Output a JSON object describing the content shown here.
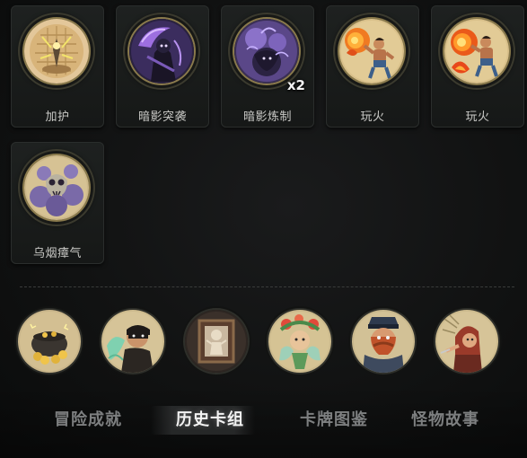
{
  "cards": [
    {
      "name": "加护",
      "icon": "golden-shield-aura-icon",
      "count": ""
    },
    {
      "name": "暗影突袭",
      "icon": "shadow-reaper-icon",
      "count": ""
    },
    {
      "name": "暗影炼制",
      "icon": "shadow-forge-icon",
      "count": "x2"
    },
    {
      "name": "玩火",
      "icon": "fire-brawler-icon",
      "count": ""
    },
    {
      "name": "玩火",
      "icon": "fire-brawler-icon",
      "count": ""
    },
    {
      "name": "乌烟瘴气",
      "icon": "smoke-skull-icon",
      "count": ""
    }
  ],
  "relics": [
    {
      "icon": "treasure-cauldron-icon"
    },
    {
      "icon": "masked-thief-icon"
    },
    {
      "icon": "framed-portrait-icon"
    },
    {
      "icon": "flower-dryad-icon"
    },
    {
      "icon": "mustached-officer-icon"
    },
    {
      "icon": "hooded-rogue-icon"
    }
  ],
  "tabs": [
    {
      "label": "冒险成就",
      "active": false
    },
    {
      "label": "历史卡组",
      "active": true
    },
    {
      "label": "卡牌图鉴",
      "active": false
    },
    {
      "label": "怪物故事",
      "active": false
    }
  ],
  "colors": {
    "background": "#111212",
    "card_frame": "#1e2120",
    "medal_rim": "#8a7a4c",
    "label_text": "#c9c9c6",
    "tab_inactive": "#7d7f80",
    "tab_active": "#f3f3f3"
  }
}
